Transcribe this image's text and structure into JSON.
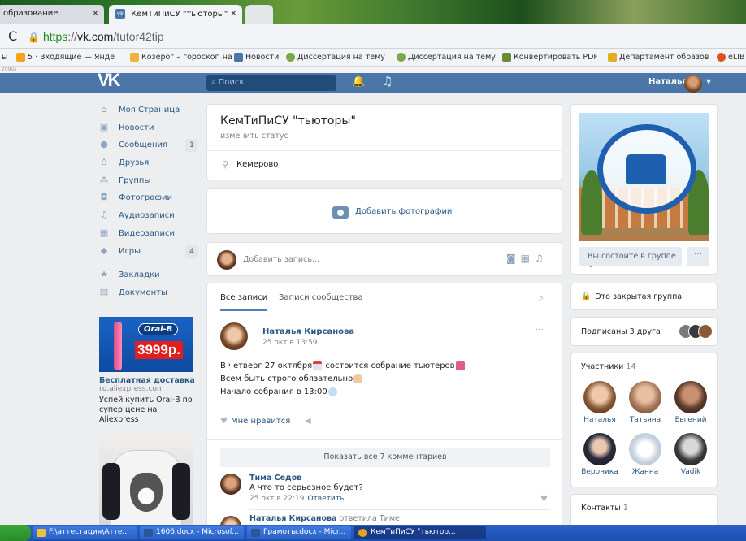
{
  "browser": {
    "tabs": [
      {
        "label": "образование",
        "active": false
      },
      {
        "label": "КемТиПиСУ \"тьюторы\"",
        "active": true
      }
    ],
    "url": {
      "scheme": "https",
      "sep": "://",
      "domain": "vk.com",
      "path": "/tutor42tip"
    },
    "bookmarks": [
      {
        "label": "5 · Входящие — Янде",
        "color": "#f3a21b"
      },
      {
        "label": "Козерог – гороскоп на",
        "color": "#f0b23a"
      },
      {
        "label": "Новости",
        "color": "#4a76a8"
      },
      {
        "label": "Диссертация на тему",
        "color": "#7aa84a"
      },
      {
        "label": "Диссертация на тему",
        "color": "#7aa84a"
      },
      {
        "label": "Конвертировать PDF",
        "color": "#6a8a3a"
      },
      {
        "label": "Департамент образов",
        "color": "#e0b020"
      },
      {
        "label": "eLIB",
        "color": "#e05020"
      }
    ],
    "status_fragment": "209us"
  },
  "vk_header": {
    "logo": "VK",
    "search_placeholder": "Поиск",
    "user_name": "Наталья"
  },
  "left_menu": [
    {
      "icon": "home-icon",
      "glyph": "⌂",
      "label": "Моя Страница",
      "badge": ""
    },
    {
      "icon": "news-icon",
      "glyph": "▣",
      "label": "Новости",
      "badge": ""
    },
    {
      "icon": "messages-icon",
      "glyph": "●",
      "label": "Сообщения",
      "badge": "1"
    },
    {
      "icon": "friend-icon",
      "glyph": "♙",
      "label": "Друзья",
      "badge": ""
    },
    {
      "icon": "groups-icon",
      "glyph": "⁂",
      "label": "Группы",
      "badge": ""
    },
    {
      "icon": "photo-icon",
      "glyph": "◘",
      "label": "Фотографии",
      "badge": ""
    },
    {
      "icon": "music-icon",
      "glyph": "♫",
      "label": "Аудиозаписи",
      "badge": ""
    },
    {
      "icon": "video-icon",
      "glyph": "▦",
      "label": "Видеозаписи",
      "badge": ""
    },
    {
      "icon": "games-icon",
      "glyph": "◆",
      "label": "Игры",
      "badge": "4"
    },
    {
      "icon": "bookmark-icon",
      "glyph": "★",
      "label": "Закладки",
      "badge": ""
    },
    {
      "icon": "document-icon",
      "glyph": "▤",
      "label": "Документы",
      "badge": ""
    }
  ],
  "ad": {
    "brand": "Oral-B",
    "price": "3999р.",
    "title": "Бесплатная доставка",
    "domain": "ru.aliexpress.com",
    "text": "Успей купить Oral-B по супер цене на Aliexpress"
  },
  "group": {
    "name": "КемТиПиСУ \"тьюторы\"",
    "status_link": "изменить статус",
    "city": "Кемерово",
    "add_photos": "Добавить фотографии",
    "add_post_placeholder": "Добавить запись..."
  },
  "feed": {
    "tab_all": "Все записи",
    "tab_community": "Записи сообщества",
    "post": {
      "author": "Наталья Кирсанова",
      "date": "25 окт в 13:59",
      "line1": "В четверг 27 октября",
      "line1b": "состоится собрание тьютеров",
      "line2": "Всем быть строго обязательно",
      "line3": "Начало собрания в 13:00",
      "like_label": "Мне нравится"
    },
    "show_all_comments": "Показать все 7 комментариев",
    "comment": {
      "author": "Тима Седов",
      "text": "А что то серьезное будет?",
      "date": "25 окт в 22:19",
      "reply_label": "Ответить"
    },
    "comment2": {
      "author": "Наталья Кирсанова",
      "reply_to": "ответила Тиме"
    }
  },
  "right": {
    "membership_button": "Вы состоите в группе",
    "more_button": "···",
    "closed_group": "Это закрытая группа",
    "friends_subscribed": "Подписаны 3 друга",
    "members_label": "Участники",
    "members_count": "14",
    "members": [
      {
        "name": "Наталья",
        "color": "#8a5a36"
      },
      {
        "name": "Татьяна",
        "color": "#a87a5a"
      },
      {
        "name": "Евгений",
        "color": "#5a3a2a"
      },
      {
        "name": "Вероника",
        "color": "#2a2a3a"
      },
      {
        "name": "Жанна",
        "color": "#c8d4e0"
      },
      {
        "name": "Vadik",
        "color": "#3a3a3a"
      }
    ],
    "contacts_label": "Контакты",
    "contacts_count": "1"
  },
  "taskbar": {
    "items": [
      {
        "label": "F:\\аттестация\\Атте...",
        "color": "#f0c040",
        "active": false
      },
      {
        "label": "1606.docx - Microsof...",
        "color": "#2b5797",
        "active": false
      },
      {
        "label": "Грамоты.docx - Micr...",
        "color": "#2b5797",
        "active": false
      },
      {
        "label": "КемТиПиСУ \"тьютор...",
        "color": "#e8a020",
        "active": true
      }
    ]
  }
}
